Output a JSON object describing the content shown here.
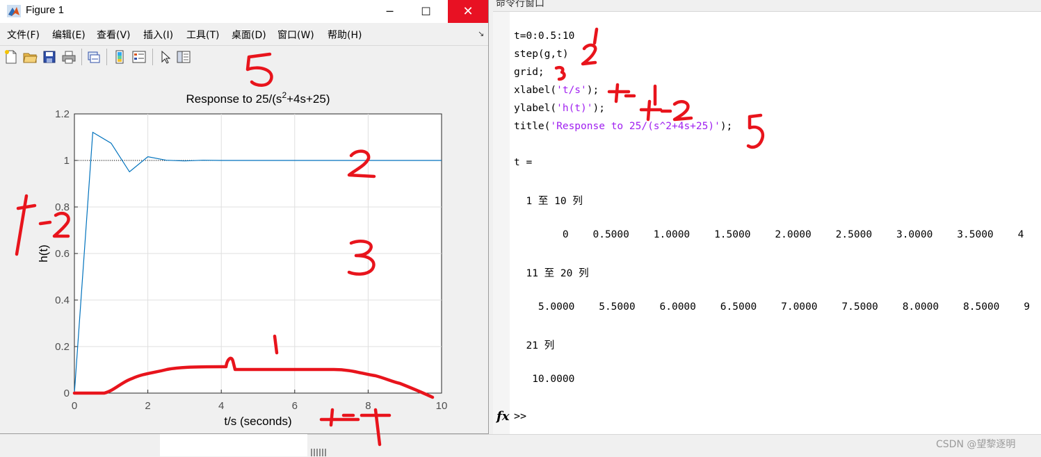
{
  "figure": {
    "title": "Figure 1",
    "min_glyph": "─",
    "max_glyph": "☐",
    "close_glyph": "✕",
    "menu": [
      "文件(F)",
      "编辑(E)",
      "查看(V)",
      "插入(I)",
      "工具(T)",
      "桌面(D)",
      "窗口(W)",
      "帮助(H)"
    ],
    "menu_corner": "↘",
    "toolbar_icons": [
      "new-figure-icon",
      "open-file-icon",
      "save-icon",
      "print-icon",
      "link-plot-icon",
      "colorbar-icon",
      "legend-icon",
      "pointer-icon",
      "property-editor-icon"
    ]
  },
  "chart_data": {
    "type": "line",
    "title": "Response to 25/(s²+4s+25)",
    "title_main": "Response to 25/(s",
    "title_sup": "2",
    "title_tail": "+4s+25)",
    "xlabel": "t/s (seconds)",
    "ylabel": "h(t)",
    "xlim": [
      0,
      10
    ],
    "ylim": [
      0,
      1.2
    ],
    "xticks": [
      "0",
      "2",
      "4",
      "6",
      "8",
      "10"
    ],
    "yticks": [
      "0",
      "0.2",
      "0.4",
      "0.6",
      "0.8",
      "1",
      "1.2"
    ],
    "grid": true,
    "reference_line": 1,
    "series": [
      {
        "color": "#0072bd",
        "x": [
          0,
          0.5,
          1,
          1.5,
          2,
          2.5,
          3,
          3.5,
          4,
          4.5,
          5,
          5.5,
          6,
          6.5,
          7,
          7.5,
          8,
          8.5,
          9,
          9.5,
          10
        ],
        "y": [
          0,
          1.121,
          1.074,
          0.951,
          1.016,
          1.001,
          0.998,
          1.001,
          1,
          1,
          1,
          1,
          1,
          1,
          1,
          1,
          1,
          1,
          1,
          1,
          1
        ]
      }
    ]
  },
  "command_window": {
    "header": "命令行窗口",
    "lines": {
      "l1": "t=0:0.5:10",
      "l2": "step(g,t)",
      "l3": "grid;",
      "l4a": "xlabel(",
      "l4s": "'t/s'",
      "l4b": ");",
      "l5a": "ylabel(",
      "l5s": "'h(t)'",
      "l5b": ");",
      "l6a": "title(",
      "l6s": "'Response to 25/(s^2+4s+25)'",
      "l6b": ");",
      "out_t": "t =",
      "cols1": "  1 至 10 列",
      "row1": "        0    0.5000    1.0000    1.5000    2.0000    2.5000    3.0000    3.5000    4",
      "cols2": "  11 至 20 列",
      "row2": "    5.0000    5.5000    6.0000    6.5000    7.0000    7.5000    8.0000    8.5000    9",
      "cols3": "  21 列",
      "row3": "   10.0000"
    },
    "fx": "fx",
    "prompt": ">>"
  },
  "annotations": {
    "a1": "1",
    "a2": "2",
    "a3": "3",
    "a5": "5",
    "a2b": "2",
    "a5b": "5",
    "a2c": "2",
    "a3b": "3",
    "a1b": "1",
    "ink_color": "#e8141c"
  },
  "watermark": "CSDN @望黎逐明"
}
